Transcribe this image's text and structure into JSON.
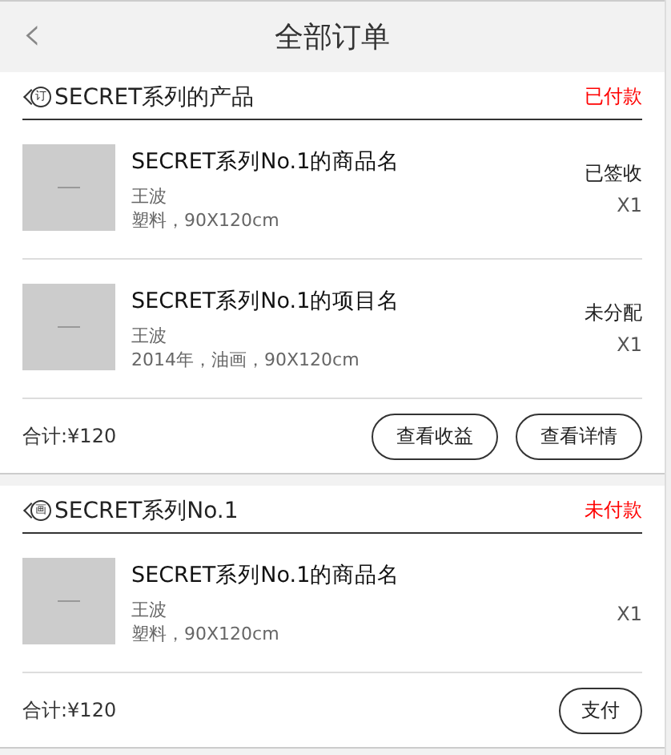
{
  "header": {
    "back": "‹",
    "title": "全部订单"
  },
  "orders": [
    {
      "tag": "订",
      "shop": "SECRET系列的产品",
      "status": "已付款",
      "items": [
        {
          "name": "SECRET系列No.1的商品名",
          "artist": "王波",
          "detail": "塑料，90X120cm",
          "state": "已签收",
          "qty": "X1"
        },
        {
          "name": "SECRET系列No.1的项目名",
          "artist": "王波",
          "detail": "2014年，油画，90X120cm",
          "state": "未分配",
          "qty": "X1"
        }
      ],
      "total": "合计:¥120",
      "buttons": [
        "查看收益",
        "查看详情"
      ]
    },
    {
      "tag": "画",
      "shop": "SECRET系列No.1",
      "status": "未付款",
      "items": [
        {
          "name": "SECRET系列No.1的商品名",
          "artist": "王波",
          "detail": "塑料，90X120cm",
          "qty": "X1"
        }
      ],
      "total": "合计:¥120",
      "buttons": [
        "支付"
      ]
    }
  ]
}
